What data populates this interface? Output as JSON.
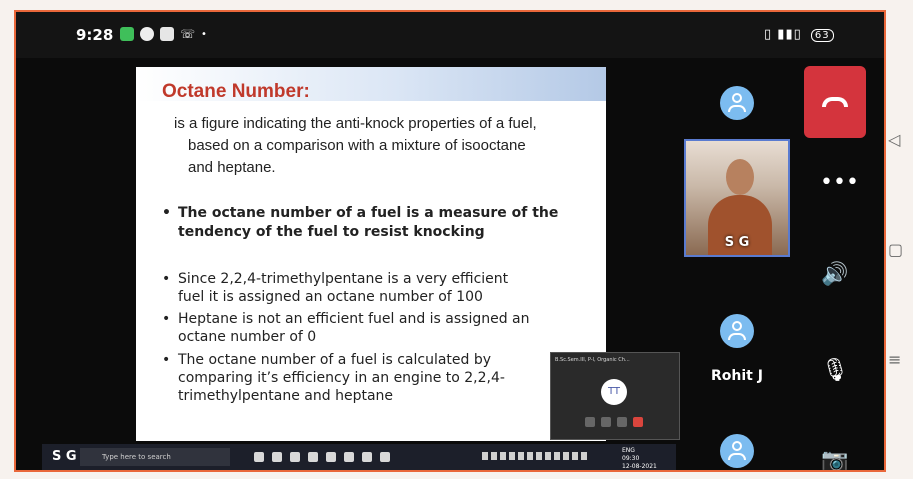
{
  "status_bar": {
    "time": "9:28",
    "battery": "63"
  },
  "slide": {
    "title": "Octane Number:",
    "definition_lines": [
      "is a figure indicating the anti-knock properties of a fuel,",
      "based on a comparison with a mixture of isooctane",
      "and heptane."
    ],
    "bullets": [
      {
        "lines": [
          "The octane number of a fuel is a measure of the",
          "tendency of the fuel to resist knocking"
        ],
        "bold": true
      },
      {
        "lines": [
          "Since 2,2,4-trimethylpentane is a very efficient",
          "fuel it is assigned an octane number of 100"
        ],
        "bold": false
      },
      {
        "lines": [
          "Heptane is not an efficient fuel and is assigned an",
          "octane number of 0"
        ],
        "bold": false
      },
      {
        "lines": [
          "The octane number of a fuel is calculated by",
          "comparing it’s efficiency  in an engine to 2,2,4-",
          "trimethylpentane and heptane"
        ],
        "bold": false
      }
    ]
  },
  "taskbar": {
    "user_label": "S G",
    "search_placeholder": "Type here to search",
    "clock_time": "09:30",
    "clock_date": "12-08-2021",
    "lang": "ENG"
  },
  "pip": {
    "header": "B.Sc.Sem.III, P-I, Organic Ch...",
    "avatar_initials": "TT"
  },
  "participants": {
    "video_name": "S G",
    "named_participant": "Rohit J"
  }
}
